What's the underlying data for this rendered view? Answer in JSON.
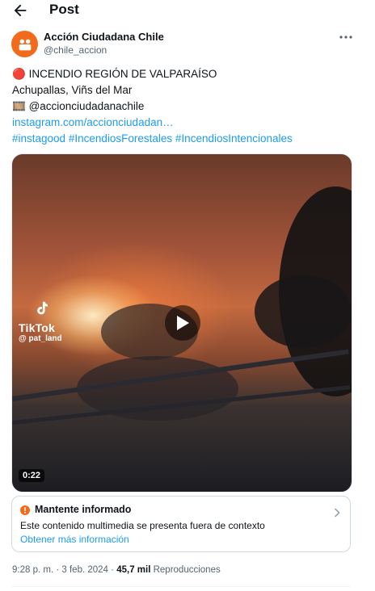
{
  "header": {
    "title": "Post"
  },
  "author": {
    "name": "Acción Ciudadana Chile",
    "handle": "@chile_accion"
  },
  "tweet": {
    "line1_emoji": "🔴",
    "line1_text": "INCENDIO REGIÓN DE VALPARAÍSO",
    "line2": "Achupallas, Viñs del Mar",
    "line3_emoji": "🎞️",
    "line3_text": "@accionciudadanachile",
    "link": "instagram.com/accionciudadan…",
    "hashtags": [
      "#instagood",
      "#IncendiosForestales",
      "#IncendiosIntencionales"
    ]
  },
  "media": {
    "tiktok_label": "TikTok",
    "tiktok_user": "@ pat_land",
    "duration": "0:22"
  },
  "notice": {
    "title": "Mantente informado",
    "description": "Este contenido multimedia se presenta fuera de contexto",
    "link": "Obtener más información"
  },
  "meta": {
    "time": "9:28 p. m.",
    "sep": "·",
    "date": "3 feb. 2024",
    "views": "45,7 mil",
    "views_label": "Reproducciones"
  },
  "colors": {
    "accent": "#1d9bf0",
    "notice_icon": "#f26a1b",
    "avatar": "#f26a1b"
  }
}
